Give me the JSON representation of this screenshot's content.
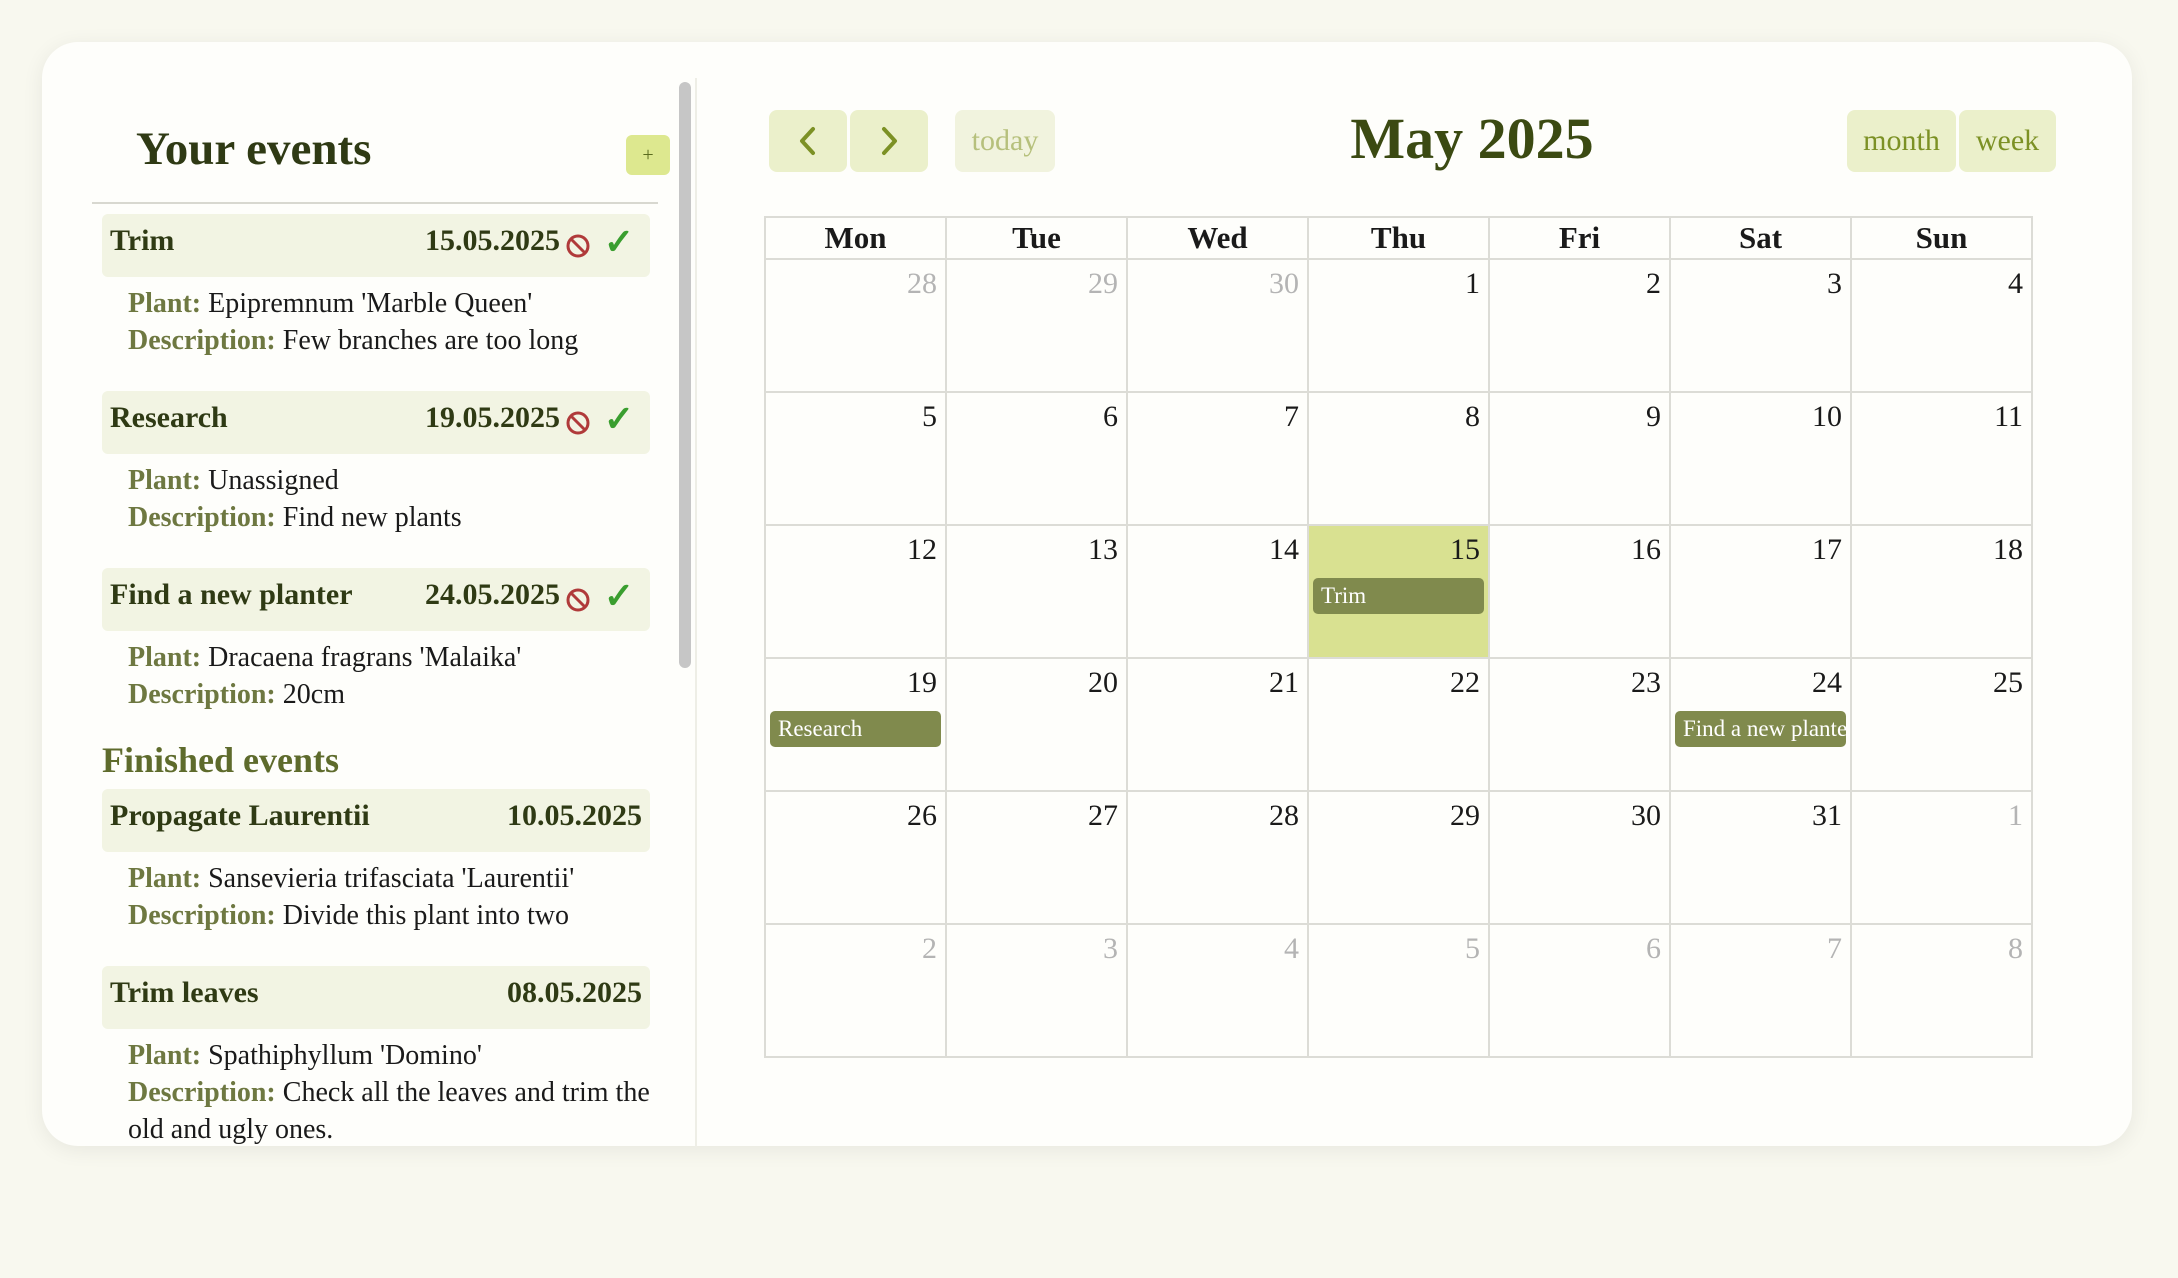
{
  "sidebar": {
    "title": "Your events",
    "add_label": "+",
    "finished_title": "Finished events",
    "labels": {
      "plant": "Plant:",
      "description": "Description:"
    },
    "events": [
      {
        "title": "Trim",
        "date": "15.05.2025",
        "plant": "Epipremnum 'Marble Queen'",
        "description": "Few branches are too long"
      },
      {
        "title": "Research",
        "date": "19.05.2025",
        "plant": "Unassigned",
        "description": "Find new plants"
      },
      {
        "title": "Find a new planter",
        "date": "24.05.2025",
        "plant": "Dracaena fragrans 'Malaika'",
        "description": "20cm"
      }
    ],
    "finished": [
      {
        "title": "Propagate Laurentii",
        "date": "10.05.2025",
        "plant": "Sansevieria trifasciata 'Laurentii'",
        "description": "Divide this plant into two"
      },
      {
        "title": "Trim leaves",
        "date": "08.05.2025",
        "plant": "Spathiphyllum 'Domino'",
        "description": "Check all the leaves and trim the old and ugly ones."
      }
    ]
  },
  "calendar": {
    "title": "May 2025",
    "today_label": "today",
    "month_label": "month",
    "week_label": "week",
    "weekdays": [
      "Mon",
      "Tue",
      "Wed",
      "Thu",
      "Fri",
      "Sat",
      "Sun"
    ],
    "weeks": [
      [
        {
          "d": "28",
          "other": true
        },
        {
          "d": "29",
          "other": true
        },
        {
          "d": "30",
          "other": true
        },
        {
          "d": "1"
        },
        {
          "d": "2"
        },
        {
          "d": "3"
        },
        {
          "d": "4"
        }
      ],
      [
        {
          "d": "5"
        },
        {
          "d": "6"
        },
        {
          "d": "7"
        },
        {
          "d": "8"
        },
        {
          "d": "9"
        },
        {
          "d": "10"
        },
        {
          "d": "11"
        }
      ],
      [
        {
          "d": "12"
        },
        {
          "d": "13"
        },
        {
          "d": "14"
        },
        {
          "d": "15",
          "today": true,
          "event": "Trim"
        },
        {
          "d": "16"
        },
        {
          "d": "17"
        },
        {
          "d": "18"
        }
      ],
      [
        {
          "d": "19",
          "event": "Research"
        },
        {
          "d": "20"
        },
        {
          "d": "21"
        },
        {
          "d": "22"
        },
        {
          "d": "23"
        },
        {
          "d": "24",
          "event": "Find a new planter"
        },
        {
          "d": "25"
        }
      ],
      [
        {
          "d": "26"
        },
        {
          "d": "27"
        },
        {
          "d": "28"
        },
        {
          "d": "29"
        },
        {
          "d": "30"
        },
        {
          "d": "31"
        },
        {
          "d": "1",
          "other": true
        }
      ],
      [
        {
          "d": "2",
          "other": true
        },
        {
          "d": "3",
          "other": true
        },
        {
          "d": "4",
          "other": true
        },
        {
          "d": "5",
          "other": true
        },
        {
          "d": "6",
          "other": true
        },
        {
          "d": "7",
          "other": true
        },
        {
          "d": "8",
          "other": true
        }
      ]
    ]
  },
  "icons": {
    "prev": "chevron-left-icon",
    "next": "chevron-right-icon",
    "cancel": "cancel-icon",
    "check": "check-icon"
  },
  "colors": {
    "accent": "#dde88f",
    "today_cell": "#d9e191",
    "event_chip": "#808a4d",
    "check": "#3a9e2f",
    "cancel": "#b03a3a"
  }
}
